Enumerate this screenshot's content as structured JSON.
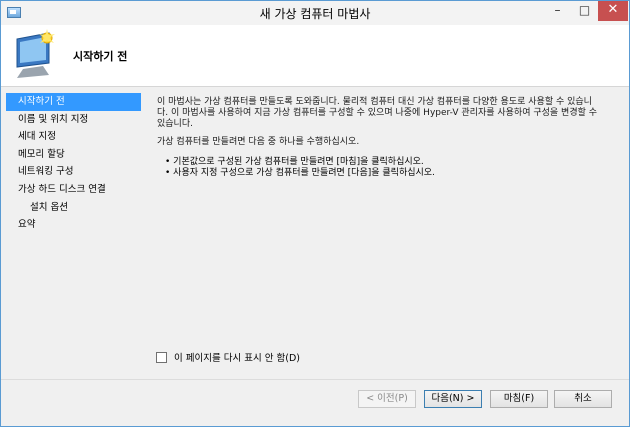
{
  "window": {
    "title": "새 가상 컴퓨터 마법사"
  },
  "header": {
    "title": "시작하기 전"
  },
  "nav": {
    "items": [
      {
        "label": "시작하기 전"
      },
      {
        "label": "이름 및 위치 지정"
      },
      {
        "label": "세대 지정"
      },
      {
        "label": "메모리 할당"
      },
      {
        "label": "네트워킹 구성"
      },
      {
        "label": "가상 하드 디스크 연결"
      },
      {
        "label": "설치 옵션"
      },
      {
        "label": "요약"
      }
    ]
  },
  "content": {
    "para1_line1": "이 마법사는 가상 컴퓨터를 만들도록 도와줍니다. 물리적 컴퓨터 대신 가상 컴퓨터를 다양한 용도로 사용할 수 있습니",
    "para1_line2": "다. 이 마법사를 사용하여 지금 가상 컴퓨터를 구성할 수 있으며 나중에 Hyper-V 관리자를 사용하여 구성을 변경할 수",
    "para1_line3": "있습니다.",
    "para2": "가상 컴퓨터를 만들려면 다음 중 하나를 수행하십시오.",
    "bullet1": "기본값으로 구성된 가상 컴퓨터를 만들려면 [마침]을 클릭하십시오.",
    "bullet2": "사용자 지정 구성으로 가상 컴퓨터를 만들려면 [다음]을 클릭하십시오."
  },
  "checkbox": {
    "label": "이 페이지를 다시 표시 안 함(D)",
    "checked": false
  },
  "buttons": {
    "prev": "< 이전(P)",
    "next": "다음(N) >",
    "finish": "마침(F)",
    "cancel": "취소"
  },
  "colors": {
    "selection": "#3399ff",
    "close_button": "#c75050"
  }
}
